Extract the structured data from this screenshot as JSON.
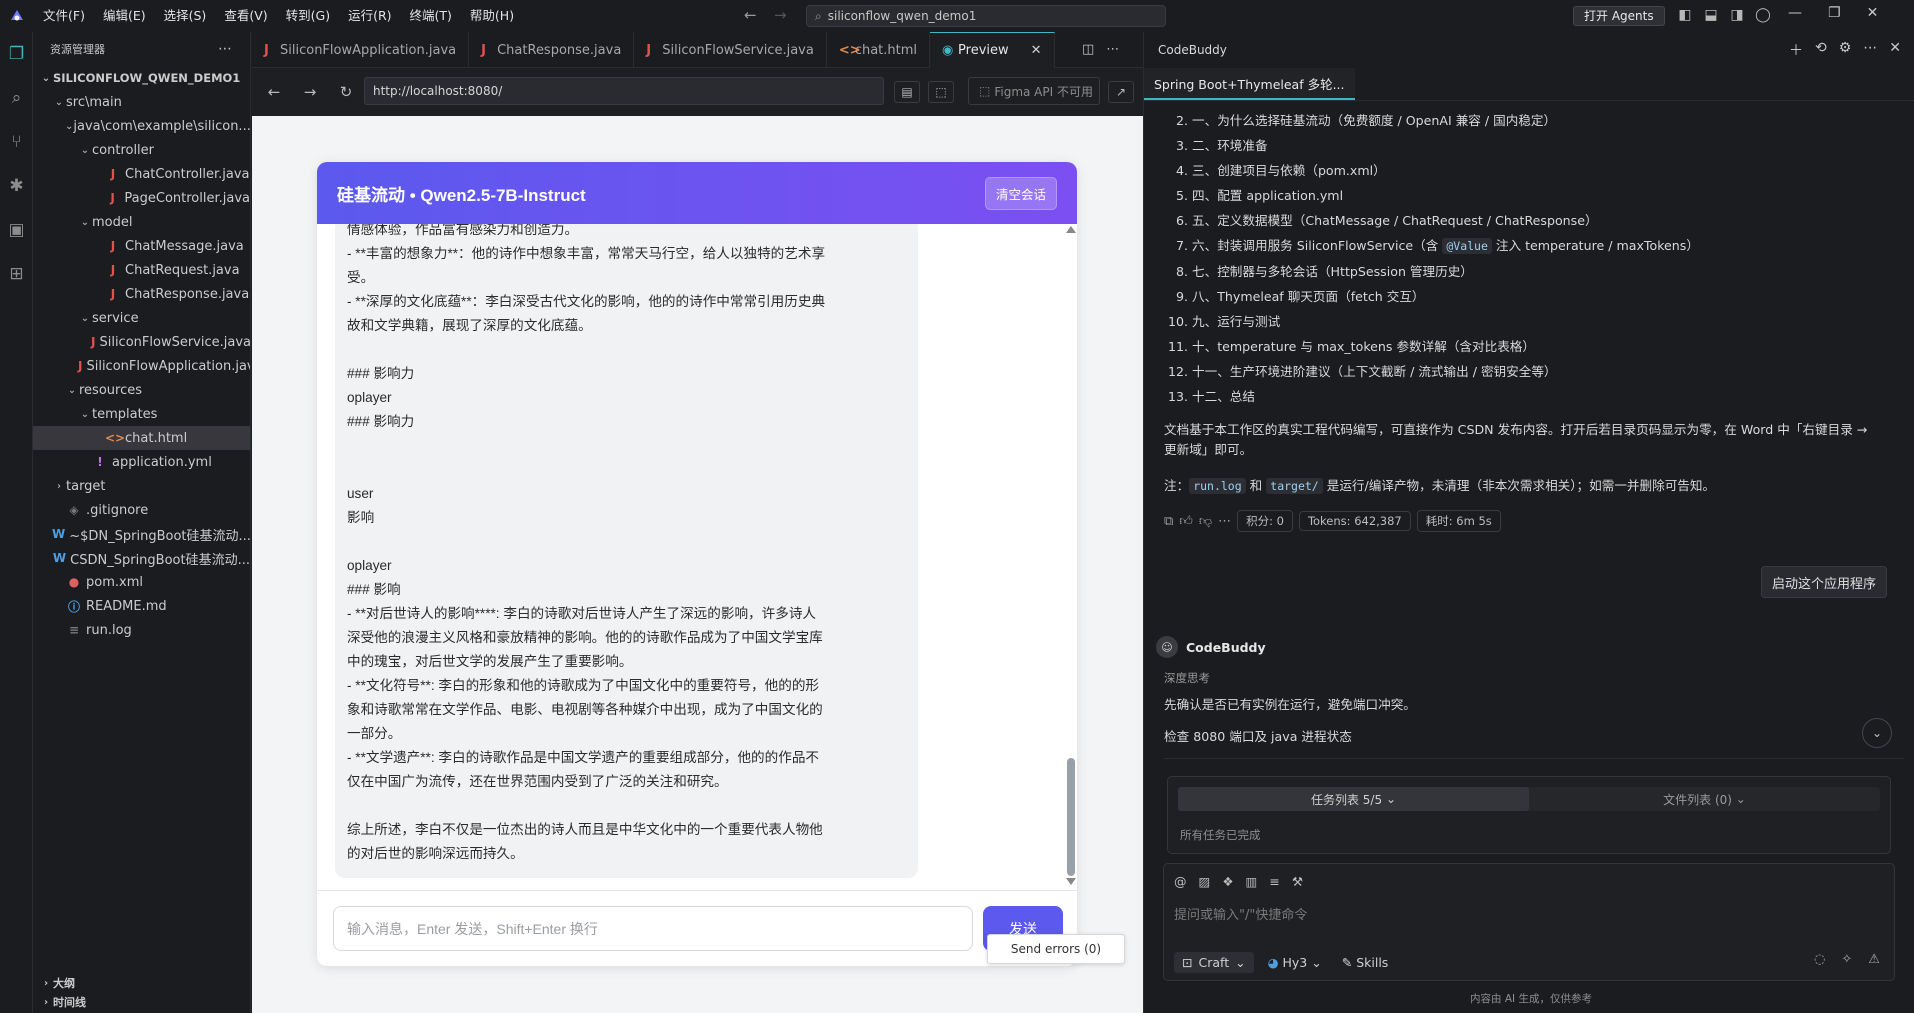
{
  "titlebar": {
    "menus": [
      "文件(F)",
      "编辑(E)",
      "选择(S)",
      "查看(V)",
      "转到(G)",
      "运行(R)",
      "终端(T)",
      "帮助(H)"
    ],
    "search": "siliconflow_qwen_demo1",
    "agents_button": "打开 Agents"
  },
  "explorer": {
    "title": "资源管理器",
    "project": "SILICONFLOW_QWEN_DEMO1",
    "rows": [
      {
        "label": "src\\main",
        "depth": 1,
        "chev": "v",
        "icon": ""
      },
      {
        "label": "java\\com\\example\\silicon...",
        "depth": 2,
        "chev": "v",
        "icon": ""
      },
      {
        "label": "controller",
        "depth": 3,
        "chev": "v",
        "icon": ""
      },
      {
        "label": "ChatController.java",
        "depth": 4,
        "chev": "",
        "icon": "J"
      },
      {
        "label": "PageController.java",
        "depth": 4,
        "chev": "",
        "icon": "J"
      },
      {
        "label": "model",
        "depth": 3,
        "chev": "v",
        "icon": ""
      },
      {
        "label": "ChatMessage.java",
        "depth": 4,
        "chev": "",
        "icon": "J"
      },
      {
        "label": "ChatRequest.java",
        "depth": 4,
        "chev": "",
        "icon": "J"
      },
      {
        "label": "ChatResponse.java",
        "depth": 4,
        "chev": "",
        "icon": "J"
      },
      {
        "label": "service",
        "depth": 3,
        "chev": "v",
        "icon": ""
      },
      {
        "label": "SiliconFlowService.java",
        "depth": 4,
        "chev": "",
        "icon": "J"
      },
      {
        "label": "SiliconFlowApplication.java",
        "depth": 3,
        "chev": "",
        "icon": "J"
      },
      {
        "label": "resources",
        "depth": 2,
        "chev": "v",
        "icon": ""
      },
      {
        "label": "templates",
        "depth": 3,
        "chev": "v",
        "icon": ""
      },
      {
        "label": "chat.html",
        "depth": 4,
        "chev": "",
        "icon": "<>",
        "selected": true
      },
      {
        "label": "application.yml",
        "depth": 3,
        "chev": "",
        "icon": "!"
      },
      {
        "label": "target",
        "depth": 1,
        "chev": ">",
        "icon": ""
      },
      {
        "label": ".gitignore",
        "depth": 1,
        "chev": "",
        "icon": "◈"
      },
      {
        "label": "~$DN_SpringBoot硅基流动...",
        "depth": 1,
        "chev": "",
        "icon": "W"
      },
      {
        "label": "CSDN_SpringBoot硅基流动...",
        "depth": 1,
        "chev": "",
        "icon": "W"
      },
      {
        "label": "pom.xml",
        "depth": 1,
        "chev": "",
        "icon": "●"
      },
      {
        "label": "README.md",
        "depth": 1,
        "chev": "",
        "icon": "ⓘ"
      },
      {
        "label": "run.log",
        "depth": 1,
        "chev": "",
        "icon": "≡"
      }
    ],
    "outline": "大纲",
    "timeline": "时间线"
  },
  "tabs": [
    {
      "label": "SiliconFlowApplication.java",
      "icon": "J"
    },
    {
      "label": "ChatResponse.java",
      "icon": "J"
    },
    {
      "label": "SiliconFlowService.java",
      "icon": "J"
    },
    {
      "label": "chat.html",
      "icon": "<>"
    },
    {
      "label": "Preview",
      "icon": "◉",
      "active": true
    }
  ],
  "preview": {
    "url": "http://localhost:8080/",
    "figma": "Figma API 不可用",
    "chat_title": "硅基流动 • Qwen2.5-7B-Instruct",
    "clear_button": "清空会话",
    "message_lines": [
      "情感体验，作品富有感染力和创造力。",
      "- **丰富的想象力**：他的诗作中想象丰富，常常天马行空，给人以独特的艺术享",
      "受。",
      "- **深厚的文化底蕴**：李白深受古代文化的影响，他的的诗作中常常引用历史典",
      "故和文学典籍，展现了深厚的文化底蕴。",
      "",
      "### 影响力",
      "oplayer",
      "### 影响力",
      "",
      "",
      "user",
      "影响",
      "",
      "oplayer",
      "### 影响",
      "- **对后世诗人的影响****: 李白的诗歌对后世诗人产生了深远的影响，许多诗人",
      "深受他的浪漫主义风格和豪放精神的影响。他的的诗歌作品成为了中国文学宝库",
      "中的瑰宝，对后世文学的发展产生了重要影响。",
      "- **文化符号**: 李白的形象和他的诗歌成为了中国文化中的重要符号，他的的形",
      "象和诗歌常常在文学作品、电影、电视剧等各种媒介中出现，成为了中国文化的",
      "一部分。",
      "- **文学遗产**: 李白的诗歌作品是中国文学遗产的重要组成部分，他的的作品不",
      "仅在中国广为流传，还在世界范围内受到了广泛的关注和研究。",
      "",
      "综上所述，李白不仅是一位杰出的诗人而且是中华文化中的一个重要代表人物他",
      "的对后世的影响深远而持久。"
    ],
    "input_placeholder": "输入消息，Enter 发送，Shift+Enter 换行",
    "send_button": "发送",
    "send_errors": "Send errors (0)"
  },
  "codebuddy": {
    "title": "CodeBuddy",
    "tab": "Spring Boot+Thymeleaf 多轮...",
    "toc": [
      {
        "n": "2.",
        "t": "一、为什么选择硅基流动（免费额度 / OpenAI 兼容 / 国内稳定）"
      },
      {
        "n": "3.",
        "t": "二、环境准备"
      },
      {
        "n": "4.",
        "t": "三、创建项目与依赖（pom.xml）"
      },
      {
        "n": "5.",
        "t": "四、配置 application.yml"
      },
      {
        "n": "6.",
        "t": "五、定义数据模型（ChatMessage / ChatRequest / ChatResponse）"
      },
      {
        "n": "7.",
        "t_pre": "六、封装调用服务 SiliconFlowService（含 ",
        "code": "@Value",
        "t_post": " 注入 temperature / maxTokens）"
      },
      {
        "n": "8.",
        "t": "七、控制器与多轮会话（HttpSession 管理历史）"
      },
      {
        "n": "9.",
        "t": "八、Thymeleaf 聊天页面（fetch 交互）"
      },
      {
        "n": "10.",
        "t": "九、运行与测试"
      },
      {
        "n": "11.",
        "t": "十、temperature 与 max_tokens 参数详解（含对比表格）"
      },
      {
        "n": "12.",
        "t": "十一、生产环境进阶建议（上下文截断 / 流式输出 / 密钥安全等）"
      },
      {
        "n": "13.",
        "t": "十二、总结"
      }
    ],
    "para1_a": "文档基于本工作区的真实工程代码编写，可直接作为 CSDN 发布内容。打开后若目录页码显示为零，在 Word 中「右键目录 →",
    "para1_b": "更新域」即可。",
    "note_prefix": "注：",
    "note_code1": "run.log",
    "note_mid": " 和 ",
    "note_code2": "target/",
    "note_suffix": " 是运行/编译产物，未清理（非本次需求相关）；如需一并删除可告知。",
    "stats": {
      "points": "积分: 0",
      "tokens": "Tokens: 642,387",
      "time": "耗时: 6m 5s"
    },
    "start_app": "启动这个应用程序",
    "author": "CodeBuddy",
    "thinking": "深度思考",
    "msg1": "先确认是否已有实例在运行，避免端口冲突。",
    "msg2": "检查 8080 端口及 java 进程状态",
    "task_tab": "任务列表 5/5",
    "file_tab": "文件列表 (0)",
    "task_done": "所有任务已完成",
    "composer_placeholder": "提问或输入\"/\"快捷命令",
    "mode": "Craft",
    "model": "Hy3",
    "skills": "Skills",
    "footer": "内容由 AI 生成，仅供参考"
  }
}
